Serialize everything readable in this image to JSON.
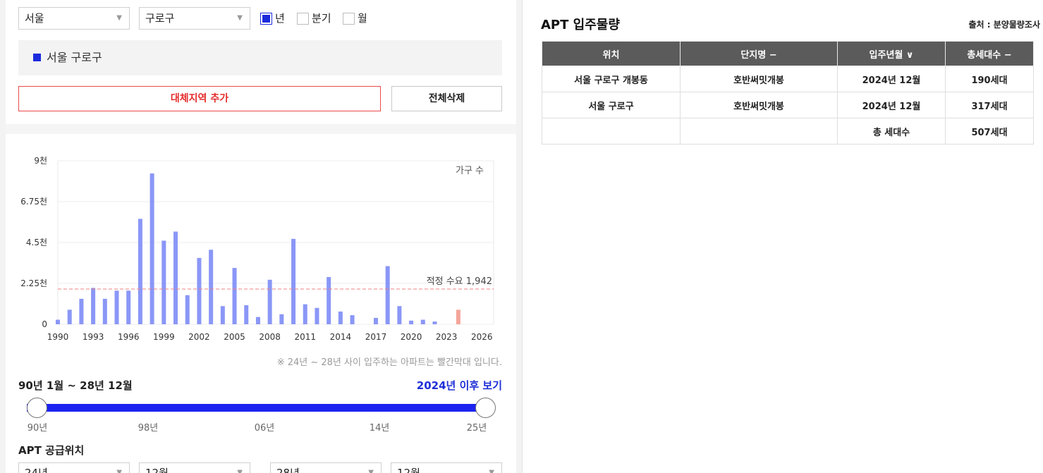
{
  "filters": {
    "city": "서울",
    "district": "구로구",
    "checkboxes": [
      {
        "label": "년",
        "checked": true
      },
      {
        "label": "분기",
        "checked": false
      },
      {
        "label": "월",
        "checked": false
      }
    ]
  },
  "region_selected": "서울 구로구",
  "buttons": {
    "add": "대체지역 추가",
    "clear": "전체삭제"
  },
  "chart_data": {
    "type": "bar",
    "series_label": "가구 수",
    "x": [
      1990,
      1991,
      1992,
      1993,
      1994,
      1995,
      1996,
      1997,
      1998,
      1999,
      2000,
      2001,
      2002,
      2003,
      2004,
      2005,
      2006,
      2007,
      2008,
      2009,
      2010,
      2011,
      2012,
      2013,
      2014,
      2015,
      2016,
      2017,
      2018,
      2019,
      2020,
      2021,
      2022,
      2023,
      2024
    ],
    "values": [
      250,
      800,
      1400,
      2000,
      1400,
      1850,
      1850,
      5800,
      8300,
      4600,
      5100,
      1600,
      3650,
      4100,
      1000,
      3100,
      1050,
      400,
      2450,
      550,
      4700,
      1100,
      900,
      2600,
      700,
      500,
      0,
      350,
      3200,
      1000,
      200,
      250,
      150,
      0,
      800
    ],
    "highlight_from": 2024,
    "x_ticks": [
      "1990",
      "1993",
      "1996",
      "1999",
      "2002",
      "2005",
      "2008",
      "2011",
      "2014",
      "2017",
      "2020",
      "2023",
      "2026"
    ],
    "y_ticks": [
      "0",
      "2.25천",
      "4.5천",
      "6.75천",
      "9천"
    ],
    "ylim": [
      0,
      9000
    ],
    "xlim": [
      1990,
      2027
    ],
    "reference_line": {
      "value": 1942,
      "label": "적정 수요 1,942"
    },
    "colors": {
      "bar": "#8a97f7",
      "highlight": "#f5a69a",
      "reference": "#f08080"
    },
    "grid": true
  },
  "note": "※ 24년 ~ 28년 사이 입주하는 아파트는 빨간막대 입니다.",
  "range": {
    "label": "90년 1월 ~ 28년 12월",
    "link": "2024년 이후 보기",
    "ticks": [
      "90년",
      "98년",
      "06년",
      "14년",
      "25년"
    ]
  },
  "supply": {
    "title": "APT 공급위치",
    "selects": [
      "24년",
      "12월",
      "28년",
      "12월"
    ]
  },
  "apt": {
    "title": "APT 입주물량",
    "source": "출처 : 분양물량조사",
    "headers": [
      "위치",
      "단지명 −",
      "입주년월 ∨",
      "총세대수 −"
    ],
    "rows": [
      [
        "서울 구로구 개봉동",
        "호반써밋개봉",
        "2024년 12월",
        "190세대"
      ],
      [
        "서울 구로구",
        "호반써밋개봉",
        "2024년 12월",
        "317세대"
      ],
      [
        "",
        "",
        "총 세대수",
        "507세대"
      ]
    ]
  }
}
